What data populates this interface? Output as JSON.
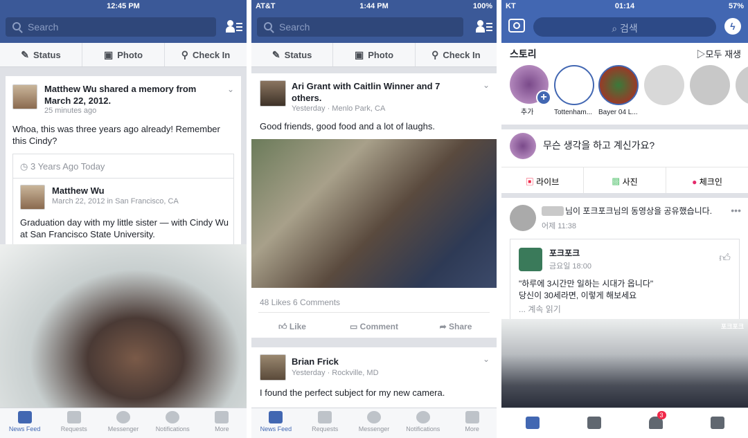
{
  "colors": {
    "fb_blue": "#3b5998",
    "active_blue": "#4267b2",
    "badge_red": "#f02849"
  },
  "screen1": {
    "status": {
      "left": "",
      "time": "12:45 PM",
      "right": ""
    },
    "search": {
      "placeholder": "Search"
    },
    "composer": {
      "status": "Status",
      "photo": "Photo",
      "checkin": "Check In"
    },
    "post": {
      "author_line": "Matthew Wu shared a memory from March 22, 2012.",
      "time": "25 minutes ago",
      "text": "Whoa, this was three years ago already! Remember this Cindy?",
      "memory_header": "3 Years Ago Today",
      "inner_author": "Matthew Wu",
      "inner_meta": "March 22, 2012 in San Francisco, CA",
      "inner_text": "Graduation day with my little sister — with Cindy Wu at San Francisco State University."
    },
    "tabs": [
      "News Feed",
      "Requests",
      "Messenger",
      "Notifications",
      "More"
    ]
  },
  "screen2": {
    "status": {
      "left": "AT&T",
      "time": "1:44 PM",
      "right": "100%"
    },
    "search": {
      "placeholder": "Search"
    },
    "composer": {
      "status": "Status",
      "photo": "Photo",
      "checkin": "Check In"
    },
    "post1": {
      "author_line": "Ari Grant with Caitlin Winner and 7 others.",
      "meta": "Yesterday · Menlo Park, CA",
      "text": "Good friends, good food and a lot of laughs.",
      "stats": "48 Likes  6 Comments",
      "actions": [
        "Like",
        "Comment",
        "Share"
      ]
    },
    "post2": {
      "author": "Brian Frick",
      "meta": "Yesterday · Rockville, MD",
      "text": "I found the perfect subject for my new camera."
    },
    "tabs": [
      "News Feed",
      "Requests",
      "Messenger",
      "Notifications",
      "More"
    ]
  },
  "screen3": {
    "status": {
      "left": "KT",
      "time": "01:14",
      "right": "57%"
    },
    "search": {
      "placeholder": "검색"
    },
    "stories": {
      "title": "스토리",
      "play_all": "모두 재생",
      "items": [
        "추가",
        "Tottenham...",
        "Bayer 04 L...",
        "",
        "",
        ""
      ]
    },
    "composer": {
      "prompt": "무슨 생각을 하고 계신가요?",
      "live": "라이브",
      "photo": "사진",
      "checkin": "체크인"
    },
    "post": {
      "author_line": "님이 포크포크님의 동영상을 공유했습니다.",
      "time": "어제 11:38",
      "page_name": "포크포크",
      "page_time": "금요일 18:00",
      "text1": "\"하루에 3시간만 일하는 시대가 옵니다\"",
      "text2": "당신이 30세라면, 이렇게 해보세요",
      "more": "... 계속 읽기",
      "video_watermark": "포크포크"
    },
    "notification_count": "3"
  }
}
